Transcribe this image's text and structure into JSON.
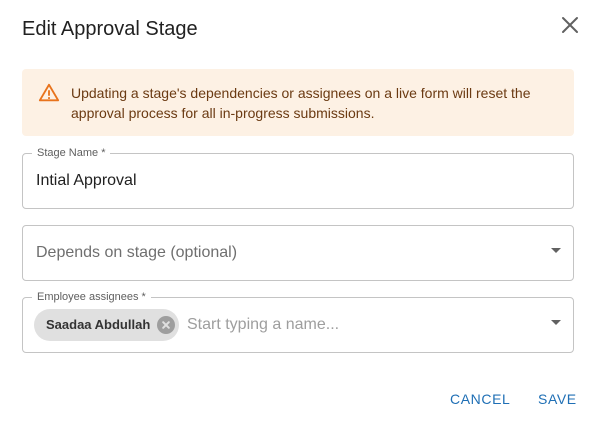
{
  "dialog": {
    "title": "Edit Approval Stage",
    "close_icon": "close-icon"
  },
  "alert": {
    "icon": "warning-icon",
    "message": "Updating a stage's dependencies or assignees on a live form will reset the approval process for all in-progress submissions.",
    "colors": {
      "background": "#fdf1e4",
      "text": "#6b3a12",
      "icon": "#e8731c"
    }
  },
  "fields": {
    "stage_name": {
      "label": "Stage Name *",
      "value": "Intial Approval"
    },
    "depends_on": {
      "placeholder": "Depends on stage (optional)",
      "icon": "chevron-down-icon"
    },
    "assignees": {
      "label": "Employee assignees *",
      "chips": [
        {
          "label": "Saadaa Abdullah",
          "icon": "cancel-circle-icon"
        }
      ],
      "placeholder": "Start typing a name...",
      "icon": "chevron-down-icon"
    }
  },
  "actions": {
    "cancel_label": "CANCEL",
    "save_label": "SAVE",
    "accent_color": "#1f6fb5"
  }
}
